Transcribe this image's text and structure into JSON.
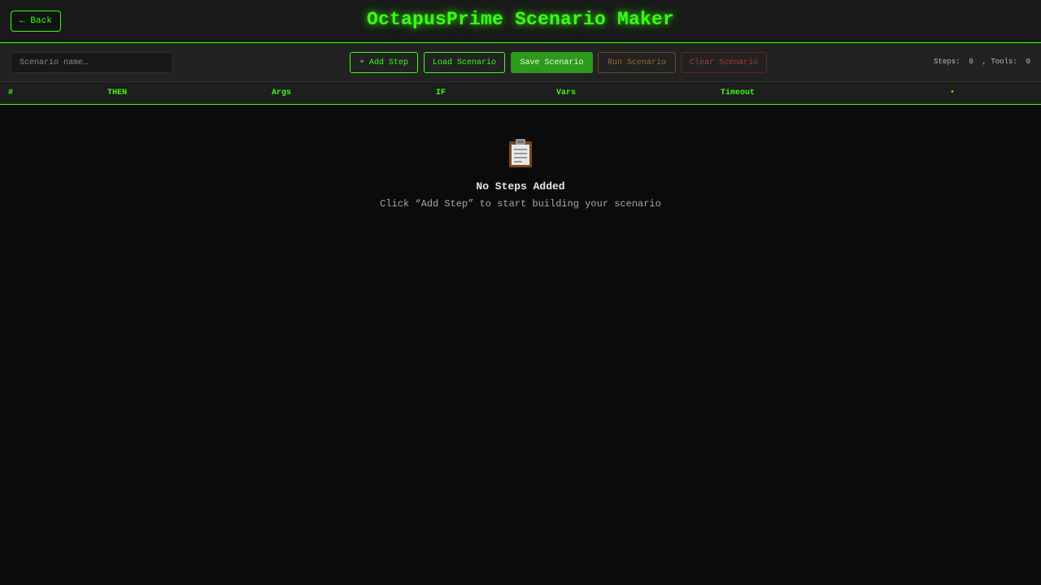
{
  "header": {
    "back_label": "← Back",
    "title": "OctapusPrime Scenario Maker"
  },
  "toolbar": {
    "scenario_name_placeholder": "Scenario name…",
    "scenario_name_value": "",
    "add_step_label": "+ Add Step",
    "load_label": "Load Scenario",
    "save_label": "Save Scenario",
    "run_label": "Run Scenario",
    "clear_label": "Clear Scenario",
    "steps_label": "Steps:",
    "steps_count": "0",
    "tools_label": ", Tools:",
    "tools_count": "0"
  },
  "table": {
    "columns": [
      "#",
      "THEN",
      "Args",
      "IF",
      "Vars",
      "Timeout",
      "•"
    ]
  },
  "empty_state": {
    "icon": "clipboard-icon",
    "title": "No Steps Added",
    "hint": "Click “Add Step” to start building your scenario"
  },
  "colors": {
    "accent": "#39ff14",
    "save_bg": "#2c9a1a",
    "run": "#9b6a2a",
    "clear": "#a73b3b",
    "background": "#0b0b0b"
  }
}
